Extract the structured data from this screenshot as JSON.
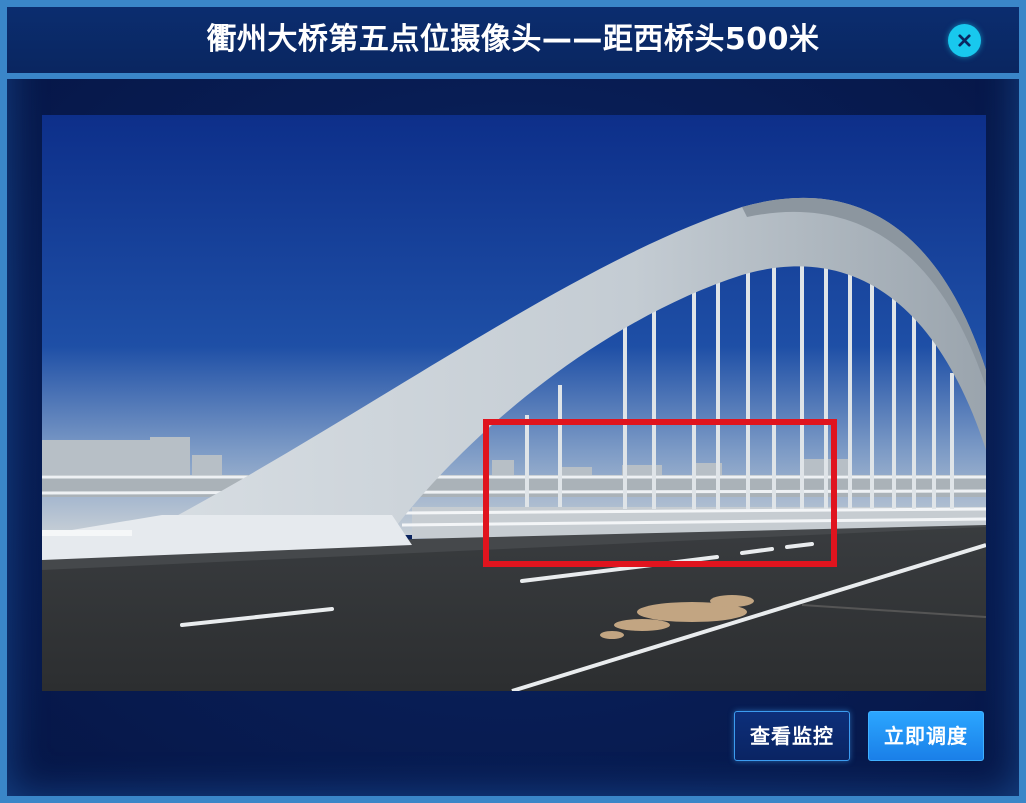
{
  "dialog": {
    "title": "衢州大桥第五点位摄像头——距西桥头500米",
    "close_icon": "close-icon"
  },
  "camera_feed": {
    "scene": "bridge-arch-camera-view",
    "alert_color": "#e0141e"
  },
  "actions": {
    "view_monitor_label": "查看监控",
    "dispatch_label": "立即调度"
  },
  "colors": {
    "border": "#3a86c8",
    "accent": "#18c8ee",
    "primary_button": "#1a7fe8",
    "background": "#081d54"
  }
}
